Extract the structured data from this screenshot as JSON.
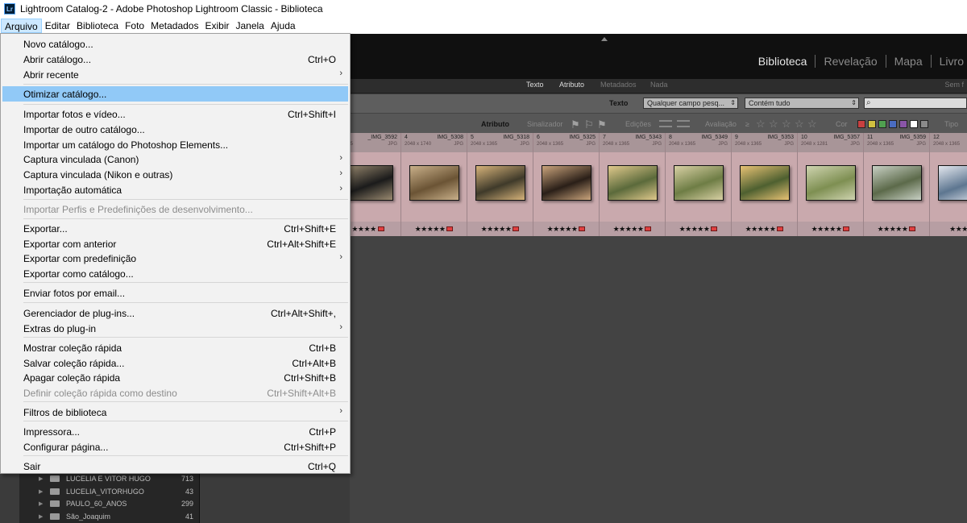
{
  "window": {
    "title": "Lightroom Catalog-2 - Adobe Photoshop Lightroom Classic - Biblioteca",
    "app_icon": "Lr"
  },
  "menubar": [
    "Arquivo",
    "Editar",
    "Biblioteca",
    "Foto",
    "Metadados",
    "Exibir",
    "Janela",
    "Ajuda"
  ],
  "modules": [
    "Biblioteca",
    "Revelação",
    "Mapa",
    "Livro"
  ],
  "filter": {
    "tabs": [
      "Texto",
      "Atributo",
      "Metadados",
      "Nada"
    ],
    "right_text": "Sem f",
    "text_label": "Texto",
    "field_select": "Qualquer campo pesq...",
    "rule_select": "Contém tudo",
    "search_icon": "search-icon",
    "attr_label": "Atributo",
    "flag_label": "Sinalizador",
    "edits_label": "Edições",
    "rating_label": "Avaliação",
    "rating_op": "≥",
    "color_label": "Cor",
    "type_label": "Tipo",
    "swatch_colors": [
      "#c84040",
      "#d0c040",
      "#50a050",
      "#4a6cc0",
      "#8a55a8",
      "#ffffff",
      "#8a8a8a"
    ]
  },
  "filmstrip": [
    {
      "idx": "",
      "name": "_IMG_3592",
      "dims": "x 1365",
      "fmt": "JPG",
      "stars": "★★★★",
      "thumb": [
        "#1b1b1b",
        "#9a8a70"
      ]
    },
    {
      "idx": "4",
      "name": "IMG_5308",
      "dims": "2048 x 1740",
      "fmt": "JPG",
      "stars": "★★★★★",
      "thumb": [
        "#6b5435",
        "#c9b08a"
      ]
    },
    {
      "idx": "5",
      "name": "IMG_5318",
      "dims": "2048 x 1365",
      "fmt": "JPG",
      "stars": "★★★★★",
      "thumb": [
        "#3f3a2a",
        "#d6b37a"
      ]
    },
    {
      "idx": "6",
      "name": "IMG_5325",
      "dims": "2048 x 1365",
      "fmt": "JPG",
      "stars": "★★★★★",
      "thumb": [
        "#2a1f18",
        "#caa47c"
      ]
    },
    {
      "idx": "7",
      "name": "IMG_5343",
      "dims": "2048 x 1365",
      "fmt": "JPG",
      "stars": "★★★★★",
      "thumb": [
        "#5b6a3b",
        "#e0c98c"
      ]
    },
    {
      "idx": "8",
      "name": "IMG_5349",
      "dims": "2048 x 1365",
      "fmt": "JPG",
      "stars": "★★★★★",
      "thumb": [
        "#6e7d45",
        "#d8d0a4"
      ]
    },
    {
      "idx": "9",
      "name": "IMG_5353",
      "dims": "2048 x 1365",
      "fmt": "JPG",
      "stars": "★★★★★",
      "thumb": [
        "#4e6030",
        "#e7c274"
      ]
    },
    {
      "idx": "10",
      "name": "IMG_5357",
      "dims": "2048 x 1281",
      "fmt": "JPG",
      "stars": "★★★★★",
      "thumb": [
        "#7e8f52",
        "#cfd4b0"
      ]
    },
    {
      "idx": "11",
      "name": "IMG_5359",
      "dims": "2048 x 1365",
      "fmt": "JPG",
      "stars": "★★★★★",
      "thumb": [
        "#5c6a4a",
        "#c8d0c4"
      ]
    },
    {
      "idx": "12",
      "name": "I",
      "dims": "2048 x 1365",
      "fmt": "",
      "stars": "★★★",
      "thumb": [
        "#5d7690",
        "#e3e7ee"
      ]
    }
  ],
  "folders": [
    {
      "name": "LUCELIA E VITOR HUGO",
      "count": "713"
    },
    {
      "name": "LUCELIA_VITORHUGO",
      "count": "43"
    },
    {
      "name": "PAULO_60_ANOS",
      "count": "299"
    },
    {
      "name": "São_Joaquim",
      "count": "41"
    }
  ],
  "menu": {
    "items": [
      {
        "label": "Novo catálogo...",
        "shortcut": ""
      },
      {
        "label": "Abrir catálogo...",
        "shortcut": "Ctrl+O"
      },
      {
        "label": "Abrir recente",
        "shortcut": "",
        "submenu": true
      },
      {
        "label": "Otimizar catálogo...",
        "shortcut": "",
        "highlighted": true
      },
      {
        "label": "Importar fotos e vídeo...",
        "shortcut": "Ctrl+Shift+I"
      },
      {
        "label": "Importar de outro catálogo...",
        "shortcut": ""
      },
      {
        "label": "Importar um catálogo do Photoshop Elements...",
        "shortcut": ""
      },
      {
        "label": "Captura vinculada (Canon)",
        "shortcut": "",
        "submenu": true
      },
      {
        "label": "Captura vinculada (Nikon e outras)",
        "shortcut": "",
        "submenu": true
      },
      {
        "label": "Importação automática",
        "shortcut": "",
        "submenu": true
      },
      {
        "label": "Importar Perfis e Predefinições de desenvolvimento...",
        "shortcut": "",
        "disabled": true
      },
      {
        "label": "Exportar...",
        "shortcut": "Ctrl+Shift+E"
      },
      {
        "label": "Exportar com anterior",
        "shortcut": "Ctrl+Alt+Shift+E"
      },
      {
        "label": "Exportar com predefinição",
        "shortcut": "",
        "submenu": true
      },
      {
        "label": "Exportar como catálogo...",
        "shortcut": ""
      },
      {
        "label": "Enviar fotos por email...",
        "shortcut": ""
      },
      {
        "label": "Gerenciador de plug-ins...",
        "shortcut": "Ctrl+Alt+Shift+,"
      },
      {
        "label": "Extras do plug-in",
        "shortcut": "",
        "submenu": true
      },
      {
        "label": "Mostrar coleção rápida",
        "shortcut": "Ctrl+B"
      },
      {
        "label": "Salvar coleção rápida...",
        "shortcut": "Ctrl+Alt+B"
      },
      {
        "label": "Apagar coleção rápida",
        "shortcut": "Ctrl+Shift+B"
      },
      {
        "label": "Definir coleção rápida como destino",
        "shortcut": "Ctrl+Shift+Alt+B",
        "disabled": true
      },
      {
        "label": "Filtros de biblioteca",
        "shortcut": "",
        "submenu": true
      },
      {
        "label": "Impressora...",
        "shortcut": "Ctrl+P"
      },
      {
        "label": "Configurar página...",
        "shortcut": "Ctrl+Shift+P"
      },
      {
        "label": "Sair",
        "shortcut": "Ctrl+Q"
      }
    ]
  }
}
